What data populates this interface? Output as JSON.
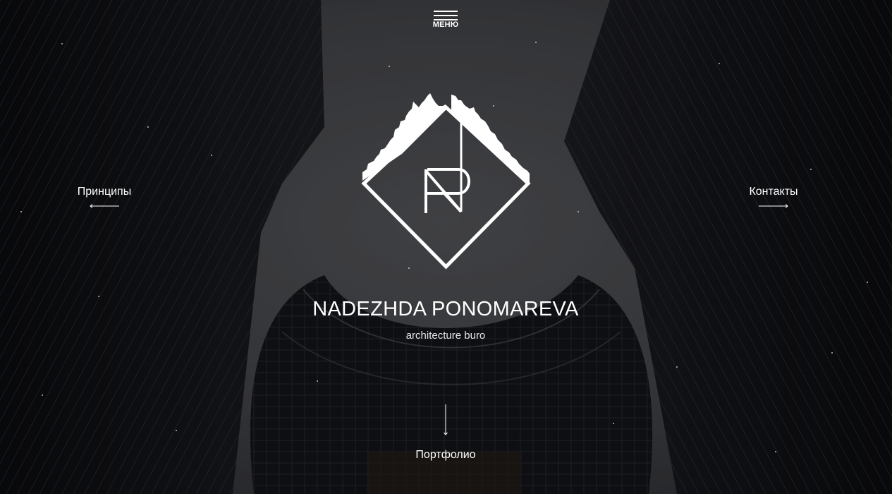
{
  "menu": {
    "label": "МЕНЮ",
    "icon": "hamburger-icon"
  },
  "brand": {
    "name": "NADEZHDA PONOMAREVA",
    "subtitle": "architecture buro",
    "logo_icon": "np-diamond-skyline-logo"
  },
  "nav": {
    "left": {
      "label": "Принципы",
      "icon": "arrow-left-icon"
    },
    "right": {
      "label": "Контакты",
      "icon": "arrow-right-icon"
    },
    "bottom": {
      "label": "Портфолио",
      "icon": "arrow-down-icon"
    }
  },
  "colors": {
    "text": "#ffffff",
    "sky": "#4b4c50",
    "buildings": "#0e1013"
  }
}
